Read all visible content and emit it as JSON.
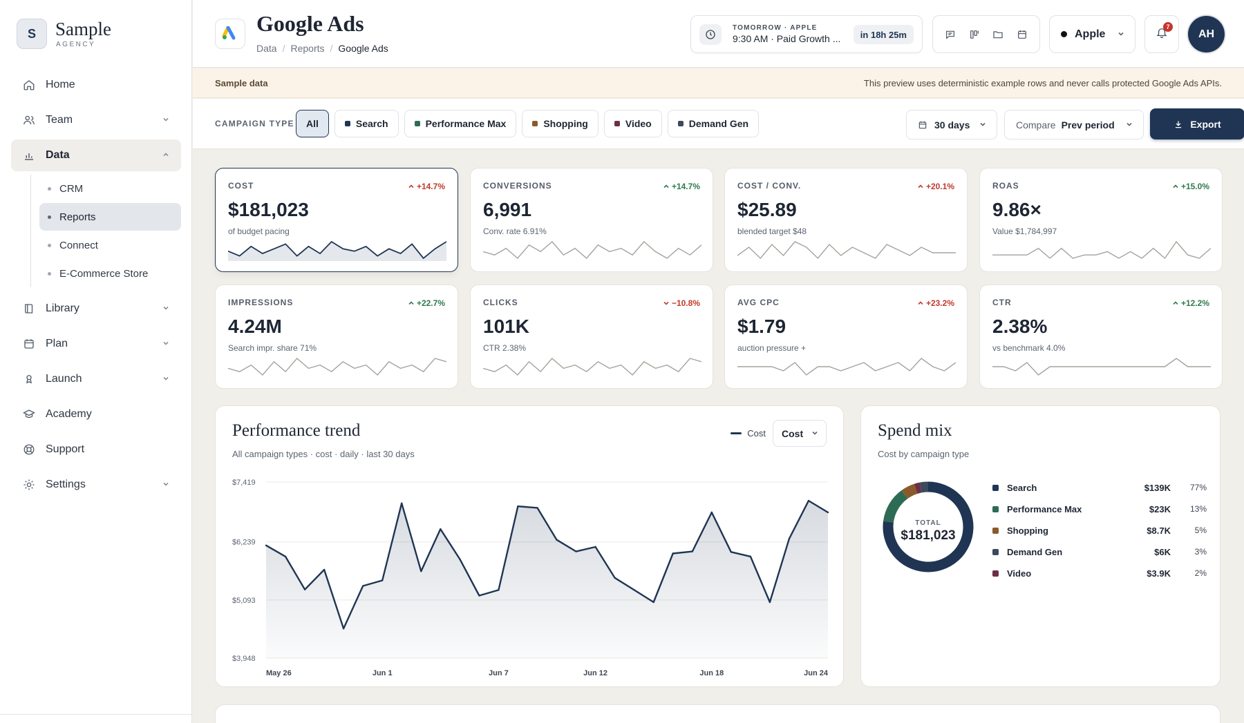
{
  "brand": {
    "initial": "S",
    "name": "Sample",
    "sub": "AGENCY"
  },
  "nav": {
    "home": "Home",
    "team": "Team",
    "data": "Data",
    "crm": "CRM",
    "reports": "Reports",
    "connect": "Connect",
    "ecommerce": "E-Commerce Store",
    "library": "Library",
    "plan": "Plan",
    "launch": "Launch",
    "academy": "Academy",
    "support": "Support",
    "settings": "Settings"
  },
  "header": {
    "title": "Google Ads",
    "breadcrumb": [
      "Data",
      "Reports",
      "Google Ads"
    ],
    "event": {
      "label": "TOMORROW · APPLE",
      "title": "9:30 AM · Paid Growth ...",
      "countdown": "in 18h 25m"
    },
    "client": "Apple",
    "notifications": "7",
    "avatar": "AH"
  },
  "notice": {
    "label": "Sample data",
    "message": "This preview uses deterministic example rows and never calls protected Google Ads APIs."
  },
  "filters": {
    "label": "CAMPAIGN TYPE",
    "chips": [
      {
        "label": "All",
        "color": ""
      },
      {
        "label": "Search",
        "color": "#1f3553"
      },
      {
        "label": "Performance Max",
        "color": "#2e6b55"
      },
      {
        "label": "Shopping",
        "color": "#8a5a2b"
      },
      {
        "label": "Video",
        "color": "#6b3048"
      },
      {
        "label": "Demand Gen",
        "color": "#3b4a5c"
      }
    ],
    "period": "30 days",
    "compare_label": "Compare",
    "compare_value": "Prev period",
    "export": "Export"
  },
  "kpis": [
    {
      "label": "COST",
      "value": "$181,023",
      "delta": "+14.7%",
      "dir": "up",
      "tone": "bad",
      "sub": "of budget pacing",
      "spark": [
        5,
        3,
        7,
        4,
        6,
        8,
        3,
        7,
        4,
        9,
        6,
        5,
        7,
        3,
        6,
        4,
        8,
        2,
        6,
        9
      ]
    },
    {
      "label": "CONVERSIONS",
      "value": "6,991",
      "delta": "+14.7%",
      "dir": "up",
      "tone": "good",
      "sub": "Conv. rate 6.91%",
      "spark": [
        5,
        4,
        6,
        3,
        7,
        5,
        8,
        4,
        6,
        3,
        7,
        5,
        6,
        4,
        8,
        5,
        3,
        6,
        4,
        7
      ]
    },
    {
      "label": "COST / CONV.",
      "value": "$25.89",
      "delta": "+20.1%",
      "dir": "up",
      "tone": "bad",
      "sub": "blended target $48",
      "spark": [
        3,
        6,
        2,
        7,
        3,
        8,
        6,
        2,
        7,
        3,
        6,
        4,
        2,
        7,
        5,
        3,
        6,
        4,
        4,
        4
      ]
    },
    {
      "label": "ROAS",
      "value": "9.86×",
      "delta": "+15.0%",
      "dir": "up",
      "tone": "good",
      "sub": "Value $1,784,997",
      "spark": [
        3,
        3,
        3,
        3,
        5,
        2,
        5,
        2,
        3,
        3,
        4,
        2,
        4,
        2,
        5,
        2,
        7,
        3,
        2,
        5
      ]
    },
    {
      "label": "IMPRESSIONS",
      "value": "4.24M",
      "delta": "+22.7%",
      "dir": "up",
      "tone": "good",
      "sub": "Search impr. share 71%",
      "spark": [
        5,
        4,
        6,
        3,
        7,
        4,
        8,
        5,
        6,
        4,
        7,
        5,
        6,
        3,
        7,
        5,
        6,
        4,
        8,
        7
      ]
    },
    {
      "label": "CLICKS",
      "value": "101K",
      "delta": "−10.8%",
      "dir": "down",
      "tone": "bad",
      "sub": "CTR 2.38%",
      "spark": [
        5,
        4,
        6,
        3,
        7,
        4,
        8,
        5,
        6,
        4,
        7,
        5,
        6,
        3,
        7,
        5,
        6,
        4,
        8,
        7
      ]
    },
    {
      "label": "AVG CPC",
      "value": "$1.79",
      "delta": "+23.2%",
      "dir": "up",
      "tone": "bad",
      "sub": "auction pressure +",
      "spark": [
        4,
        4,
        4,
        4,
        3,
        5,
        2,
        4,
        4,
        3,
        4,
        5,
        3,
        4,
        5,
        3,
        6,
        4,
        3,
        5
      ]
    },
    {
      "label": "CTR",
      "value": "2.38%",
      "delta": "+12.2%",
      "dir": "up",
      "tone": "good",
      "sub": "vs benchmark 4.0%",
      "spark": [
        4,
        4,
        3,
        5,
        2,
        4,
        4,
        4,
        4,
        4,
        4,
        4,
        4,
        4,
        4,
        4,
        6,
        4,
        4,
        4
      ]
    }
  ],
  "trend": {
    "title": "Performance trend",
    "subtitle": "All campaign types · cost · daily · last 30 days",
    "legend": "Cost",
    "metric": "Cost"
  },
  "chart_data": {
    "type": "area",
    "title": "Performance trend",
    "ylabel": "",
    "xlabel": "",
    "y_ticks": [
      "$7,419",
      "$6,239",
      "$5,093",
      "$3,948"
    ],
    "y_tick_values": [
      7419,
      6239,
      5093,
      3948
    ],
    "x_ticks": [
      "May 26",
      "Jun 1",
      "Jun 7",
      "Jun 12",
      "Jun 18",
      "Jun 24"
    ],
    "x_tick_index": [
      0,
      6,
      12,
      17,
      23,
      29
    ],
    "ylim": [
      3948,
      7419
    ],
    "series": [
      {
        "name": "Cost",
        "values": [
          6170,
          5950,
          5300,
          5690,
          4530,
          5370,
          5480,
          7000,
          5660,
          6490,
          5900,
          5180,
          5290,
          6940,
          6910,
          6280,
          6050,
          6140,
          5530,
          5290,
          5050,
          6010,
          6050,
          6820,
          6040,
          5950,
          5050,
          6300,
          7050,
          6820
        ]
      }
    ],
    "x_dates": [
      "May 26",
      "May 27",
      "May 28",
      "May 29",
      "May 30",
      "May 31",
      "Jun 1",
      "Jun 2",
      "Jun 3",
      "Jun 4",
      "Jun 5",
      "Jun 6",
      "Jun 7",
      "Jun 8",
      "Jun 9",
      "Jun 10",
      "Jun 11",
      "Jun 12",
      "Jun 13",
      "Jun 14",
      "Jun 15",
      "Jun 16",
      "Jun 17",
      "Jun 18",
      "Jun 19",
      "Jun 20",
      "Jun 21",
      "Jun 22",
      "Jun 23",
      "Jun 24"
    ]
  },
  "mix": {
    "title": "Spend mix",
    "subtitle": "Cost by campaign type",
    "total_label": "TOTAL",
    "total_value": "$181,023",
    "rows": [
      {
        "name": "Search",
        "amount": "$139K",
        "pct": "77%",
        "share": 77,
        "color": "#1f3553"
      },
      {
        "name": "Performance Max",
        "amount": "$23K",
        "pct": "13%",
        "share": 13,
        "color": "#2e6b55"
      },
      {
        "name": "Shopping",
        "amount": "$8.7K",
        "pct": "5%",
        "share": 5,
        "color": "#8a5a2b"
      },
      {
        "name": "Demand Gen",
        "amount": "$6K",
        "pct": "3%",
        "share": 3,
        "color": "#3b4a5c"
      },
      {
        "name": "Video",
        "amount": "$3.9K",
        "pct": "2%",
        "share": 2,
        "color": "#6b3048"
      }
    ]
  }
}
